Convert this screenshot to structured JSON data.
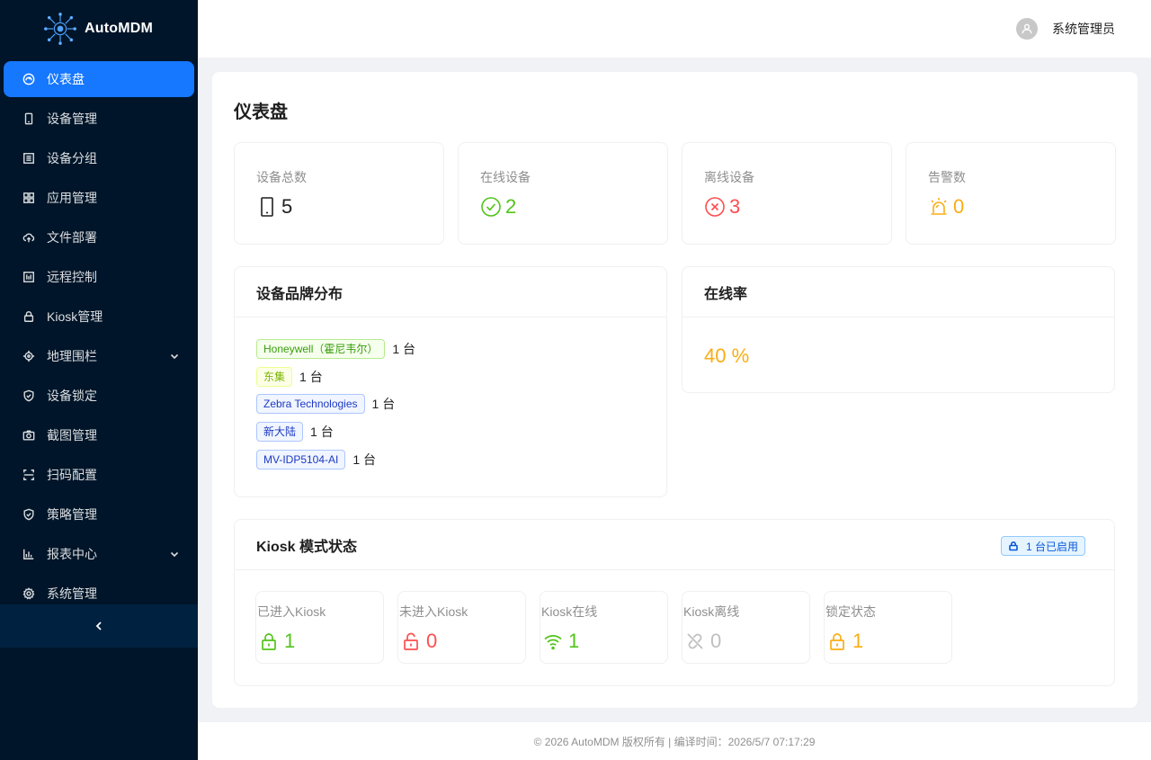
{
  "app": {
    "name": "AutoMDM",
    "logo_icon": "network-globe-logo"
  },
  "sidebar": {
    "items": [
      {
        "label": "仪表盘",
        "icon": "dashboard-icon",
        "active": true
      },
      {
        "label": "设备管理",
        "icon": "mobile-icon"
      },
      {
        "label": "设备分组",
        "icon": "group-icon"
      },
      {
        "label": "应用管理",
        "icon": "apps-icon"
      },
      {
        "label": "文件部署",
        "icon": "cloud-upload-icon"
      },
      {
        "label": "远程控制",
        "icon": "remote-control-icon"
      },
      {
        "label": "Kiosk管理",
        "icon": "lock-icon"
      },
      {
        "label": "地理围栏",
        "icon": "aim-icon",
        "expandable": true
      },
      {
        "label": "设备锁定",
        "icon": "safety-icon"
      },
      {
        "label": "截图管理",
        "icon": "camera-icon"
      },
      {
        "label": "扫码配置",
        "icon": "scan-icon"
      },
      {
        "label": "策略管理",
        "icon": "policy-icon"
      },
      {
        "label": "报表中心",
        "icon": "bar-chart-icon",
        "expandable": true
      },
      {
        "label": "系统管理",
        "icon": "setting-icon"
      }
    ],
    "collapse_icon": "left-arrow-icon"
  },
  "header": {
    "username": "系统管理员",
    "avatar_icon": "user-icon"
  },
  "page": {
    "title": "仪表盘"
  },
  "stats": [
    {
      "label": "设备总数",
      "value": "5",
      "icon": "mobile-icon",
      "color": "#1f1f1f"
    },
    {
      "label": "在线设备",
      "value": "2",
      "icon": "check-circle-icon",
      "color": "#52c41a"
    },
    {
      "label": "离线设备",
      "value": "3",
      "icon": "close-circle-icon",
      "color": "#ff4d4f"
    },
    {
      "label": "告警数",
      "value": "0",
      "icon": "alert-icon",
      "color": "#faad14"
    }
  ],
  "brands": {
    "title": "设备品牌分布",
    "items": [
      {
        "name": "Honeywell（霍尼韦尔）",
        "count": "1 台",
        "tag_color": "green"
      },
      {
        "name": "东集",
        "count": "1 台",
        "tag_color": "lime"
      },
      {
        "name": "Zebra Technologies",
        "count": "1 台",
        "tag_color": "geekblue"
      },
      {
        "name": "新大陆",
        "count": "1 台",
        "tag_color": "geekblue"
      },
      {
        "name": "MV-IDP5104-AI",
        "count": "1 台",
        "tag_color": "geekblue"
      }
    ]
  },
  "online_rate": {
    "title": "在线率",
    "value": "40 %",
    "color": "#faad14"
  },
  "kiosk": {
    "title": "Kiosk 模式状态",
    "badge": "1 台已启用",
    "cards": [
      {
        "label": "已进入Kiosk",
        "value": "1",
        "icon": "lock-icon",
        "color": "#52c41a"
      },
      {
        "label": "未进入Kiosk",
        "value": "0",
        "icon": "unlock-icon",
        "color": "#ff4d4f"
      },
      {
        "label": "Kiosk在线",
        "value": "1",
        "icon": "wifi-icon",
        "color": "#52c41a"
      },
      {
        "label": "Kiosk离线",
        "value": "0",
        "icon": "disconnect-icon",
        "color": "#bfbfbf"
      },
      {
        "label": "锁定状态",
        "value": "1",
        "icon": "lock-icon",
        "color": "#faad14"
      }
    ]
  },
  "footer": {
    "text": "© 2026 AutoMDM 版权所有 | 编译时间：2026/5/7 07:17:29"
  }
}
